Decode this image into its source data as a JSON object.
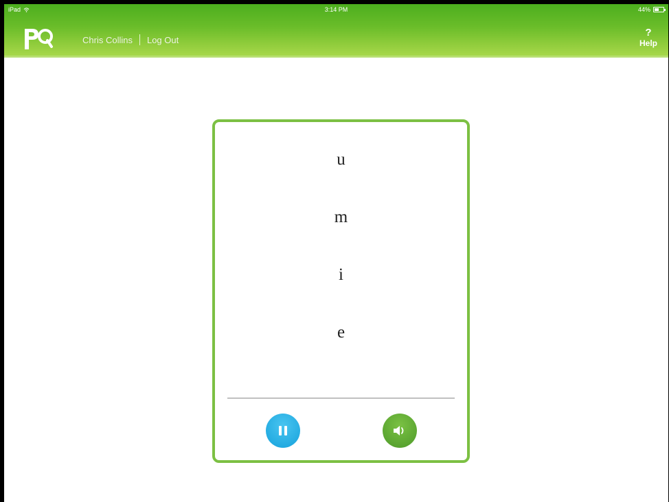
{
  "status_bar": {
    "device": "iPad",
    "time": "3:14 PM",
    "battery": "44%"
  },
  "header": {
    "logo_text": "PQ",
    "user_name": "Chris Collins",
    "logout_label": "Log Out",
    "help_icon": "?",
    "help_label": "Help",
    "accent_color": "#6bbd2a"
  },
  "card": {
    "letters": [
      "u",
      "m",
      "i",
      "e"
    ],
    "border_color": "#7cc043",
    "pause_button": {
      "icon": "pause-icon",
      "color": "#16a2dc"
    },
    "sound_button": {
      "icon": "speaker-icon",
      "color": "#4e9a2a"
    }
  }
}
